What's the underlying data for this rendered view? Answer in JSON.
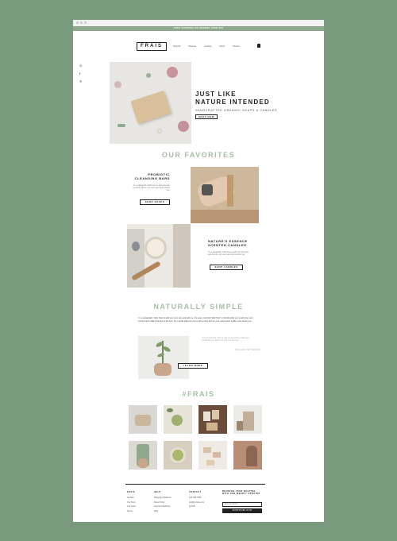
{
  "topbar": {
    "text": "FREE SHIPPING ON ORDERS OVER $50"
  },
  "nav": {
    "logo": "FRAIS",
    "links": [
      "Shop All",
      "Cleanser",
      "Candles",
      "About",
      "Contact"
    ]
  },
  "social": [
    "instagram-icon",
    "facebook-icon",
    "pinterest-icon"
  ],
  "hero": {
    "title_line1": "JUST LIKE",
    "title_line2": "NATURE INTENDED",
    "subtitle": "HANDCRAFTED ORGANIC SOAPS & CANDLES",
    "button": "SHOP NOW"
  },
  "favorites": {
    "title": "OUR FAVORITES",
    "item1": {
      "title_line1": "PROBIOTIC",
      "title_line2": "CLEANSING BARS",
      "text": "I'm a paragraph. Click here to add your own text and edit me. Let your users get to know you.",
      "button": "SHOP SOAPS"
    },
    "item2": {
      "title_line1": "NATURE'S ESSENCE",
      "title_line2": "SCENTED CANDLES",
      "text": "I'm a paragraph. Click here to add your own text and edit me. Let your users get to know you.",
      "button": "SHOP CANDLES"
    }
  },
  "naturally": {
    "title": "NATURALLY SIMPLE",
    "paragraph": "I'm a paragraph. Click here to add your own text and edit me. It's easy, just click \"Edit Text\" or double click me to add your own content and make changes to the font. I'm a great place for you to tell a story and let your users know a little more about you.",
    "quote": "\"I'm a testimonial. Click to edit me and add text that says something nice about you and your services.\"",
    "quote_author": "WILLIAM PATTERSON",
    "button": "LEARN MORE"
  },
  "instagram": {
    "title": "#FRAIS"
  },
  "footer": {
    "col1": {
      "heading": "FRAIS",
      "items": [
        "Contact",
        "Our Story",
        "Our Team",
        "Stores"
      ]
    },
    "col2": {
      "heading": "HELP",
      "items": [
        "Shipping & Returns",
        "Store Policy",
        "Payment Methods",
        "FAQ"
      ]
    },
    "col3": {
      "heading": "CONTACT",
      "items": [
        "123-456-7890",
        "info@mysite.com"
      ]
    },
    "newsletter": {
      "heading_line1": "REFRESH YOUR ROUTINE",
      "heading_line2": "WITH OUR WEEKLY UPDATES",
      "placeholder": "Enter Email Here",
      "button": "SUBSCRIBE NOW"
    }
  },
  "colors": {
    "background": "#7a9a7d",
    "accent": "#a7bfa5"
  }
}
